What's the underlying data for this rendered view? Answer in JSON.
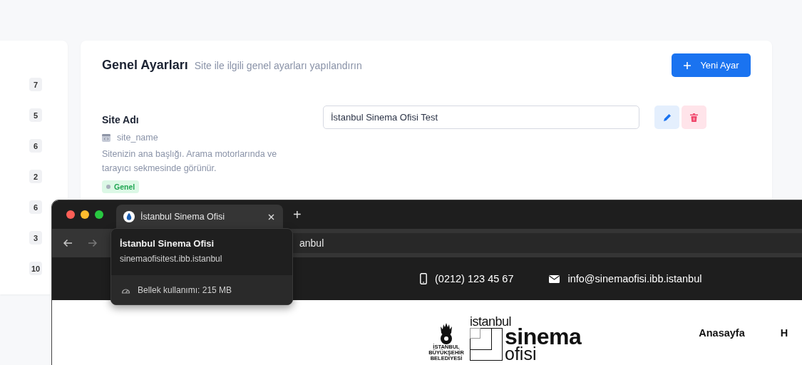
{
  "sidebar": {
    "counts": [
      "7",
      "5",
      "6",
      "2",
      "6",
      "3",
      "10"
    ]
  },
  "section": {
    "title": "Genel Ayarları",
    "subtitle": "Site ile ilgili genel ayarları yapılandırın",
    "new_button": "Yeni Ayar"
  },
  "settings": [
    {
      "label": "Site Adı",
      "key": "site_name",
      "description": "Sitenizin ana başlığı. Arama motorlarında ve tarayıcı sekmesinde görünür.",
      "tag": "Genel",
      "value": "İstanbul Sinema Ofisi Test"
    }
  ],
  "browser": {
    "tabs": [
      {
        "title": "İstanbul Sinema Ofisi",
        "selected": true
      }
    ],
    "new_tab": "+",
    "address": "anbul",
    "tooltip": {
      "title": "İstanbul Sinema Ofisi",
      "url": "sinemaofisitest.ibb.istanbul",
      "memory": "Bellek kullanımı: 215 MB"
    },
    "site": {
      "phone": "(0212) 123 45 67",
      "email": "info@sinemaofisi.ibb.istanbul",
      "logo": {
        "emblem_lines": [
          "İSTANBUL",
          "BÜYÜKŞEHİR",
          "BELEDİYESİ"
        ],
        "top": "istanbul",
        "main": "sinema",
        "bottom": "ofisi"
      },
      "nav": [
        {
          "label": "Anasayfa"
        },
        {
          "label": "H"
        }
      ]
    }
  }
}
